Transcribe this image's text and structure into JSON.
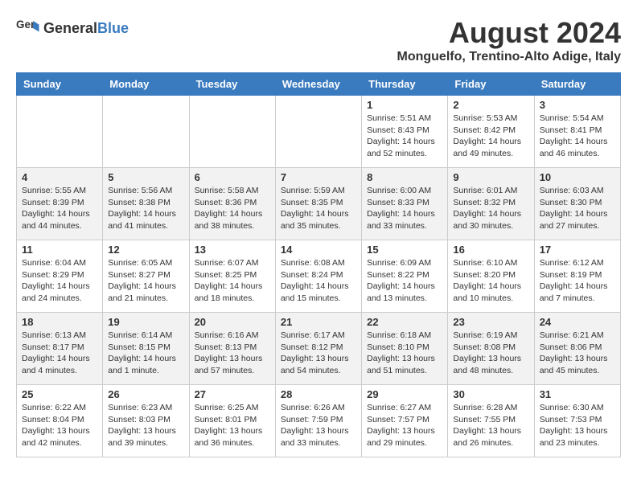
{
  "header": {
    "logo_general": "General",
    "logo_blue": "Blue",
    "title": "August 2024",
    "location": "Monguelfo, Trentino-Alto Adige, Italy"
  },
  "weekdays": [
    "Sunday",
    "Monday",
    "Tuesday",
    "Wednesday",
    "Thursday",
    "Friday",
    "Saturday"
  ],
  "weeks": [
    [
      {
        "day": "",
        "info": ""
      },
      {
        "day": "",
        "info": ""
      },
      {
        "day": "",
        "info": ""
      },
      {
        "day": "",
        "info": ""
      },
      {
        "day": "1",
        "info": "Sunrise: 5:51 AM\nSunset: 8:43 PM\nDaylight: 14 hours and 52 minutes."
      },
      {
        "day": "2",
        "info": "Sunrise: 5:53 AM\nSunset: 8:42 PM\nDaylight: 14 hours and 49 minutes."
      },
      {
        "day": "3",
        "info": "Sunrise: 5:54 AM\nSunset: 8:41 PM\nDaylight: 14 hours and 46 minutes."
      }
    ],
    [
      {
        "day": "4",
        "info": "Sunrise: 5:55 AM\nSunset: 8:39 PM\nDaylight: 14 hours and 44 minutes."
      },
      {
        "day": "5",
        "info": "Sunrise: 5:56 AM\nSunset: 8:38 PM\nDaylight: 14 hours and 41 minutes."
      },
      {
        "day": "6",
        "info": "Sunrise: 5:58 AM\nSunset: 8:36 PM\nDaylight: 14 hours and 38 minutes."
      },
      {
        "day": "7",
        "info": "Sunrise: 5:59 AM\nSunset: 8:35 PM\nDaylight: 14 hours and 35 minutes."
      },
      {
        "day": "8",
        "info": "Sunrise: 6:00 AM\nSunset: 8:33 PM\nDaylight: 14 hours and 33 minutes."
      },
      {
        "day": "9",
        "info": "Sunrise: 6:01 AM\nSunset: 8:32 PM\nDaylight: 14 hours and 30 minutes."
      },
      {
        "day": "10",
        "info": "Sunrise: 6:03 AM\nSunset: 8:30 PM\nDaylight: 14 hours and 27 minutes."
      }
    ],
    [
      {
        "day": "11",
        "info": "Sunrise: 6:04 AM\nSunset: 8:29 PM\nDaylight: 14 hours and 24 minutes."
      },
      {
        "day": "12",
        "info": "Sunrise: 6:05 AM\nSunset: 8:27 PM\nDaylight: 14 hours and 21 minutes."
      },
      {
        "day": "13",
        "info": "Sunrise: 6:07 AM\nSunset: 8:25 PM\nDaylight: 14 hours and 18 minutes."
      },
      {
        "day": "14",
        "info": "Sunrise: 6:08 AM\nSunset: 8:24 PM\nDaylight: 14 hours and 15 minutes."
      },
      {
        "day": "15",
        "info": "Sunrise: 6:09 AM\nSunset: 8:22 PM\nDaylight: 14 hours and 13 minutes."
      },
      {
        "day": "16",
        "info": "Sunrise: 6:10 AM\nSunset: 8:20 PM\nDaylight: 14 hours and 10 minutes."
      },
      {
        "day": "17",
        "info": "Sunrise: 6:12 AM\nSunset: 8:19 PM\nDaylight: 14 hours and 7 minutes."
      }
    ],
    [
      {
        "day": "18",
        "info": "Sunrise: 6:13 AM\nSunset: 8:17 PM\nDaylight: 14 hours and 4 minutes."
      },
      {
        "day": "19",
        "info": "Sunrise: 6:14 AM\nSunset: 8:15 PM\nDaylight: 14 hours and 1 minute."
      },
      {
        "day": "20",
        "info": "Sunrise: 6:16 AM\nSunset: 8:13 PM\nDaylight: 13 hours and 57 minutes."
      },
      {
        "day": "21",
        "info": "Sunrise: 6:17 AM\nSunset: 8:12 PM\nDaylight: 13 hours and 54 minutes."
      },
      {
        "day": "22",
        "info": "Sunrise: 6:18 AM\nSunset: 8:10 PM\nDaylight: 13 hours and 51 minutes."
      },
      {
        "day": "23",
        "info": "Sunrise: 6:19 AM\nSunset: 8:08 PM\nDaylight: 13 hours and 48 minutes."
      },
      {
        "day": "24",
        "info": "Sunrise: 6:21 AM\nSunset: 8:06 PM\nDaylight: 13 hours and 45 minutes."
      }
    ],
    [
      {
        "day": "25",
        "info": "Sunrise: 6:22 AM\nSunset: 8:04 PM\nDaylight: 13 hours and 42 minutes."
      },
      {
        "day": "26",
        "info": "Sunrise: 6:23 AM\nSunset: 8:03 PM\nDaylight: 13 hours and 39 minutes."
      },
      {
        "day": "27",
        "info": "Sunrise: 6:25 AM\nSunset: 8:01 PM\nDaylight: 13 hours and 36 minutes."
      },
      {
        "day": "28",
        "info": "Sunrise: 6:26 AM\nSunset: 7:59 PM\nDaylight: 13 hours and 33 minutes."
      },
      {
        "day": "29",
        "info": "Sunrise: 6:27 AM\nSunset: 7:57 PM\nDaylight: 13 hours and 29 minutes."
      },
      {
        "day": "30",
        "info": "Sunrise: 6:28 AM\nSunset: 7:55 PM\nDaylight: 13 hours and 26 minutes."
      },
      {
        "day": "31",
        "info": "Sunrise: 6:30 AM\nSunset: 7:53 PM\nDaylight: 13 hours and 23 minutes."
      }
    ]
  ]
}
